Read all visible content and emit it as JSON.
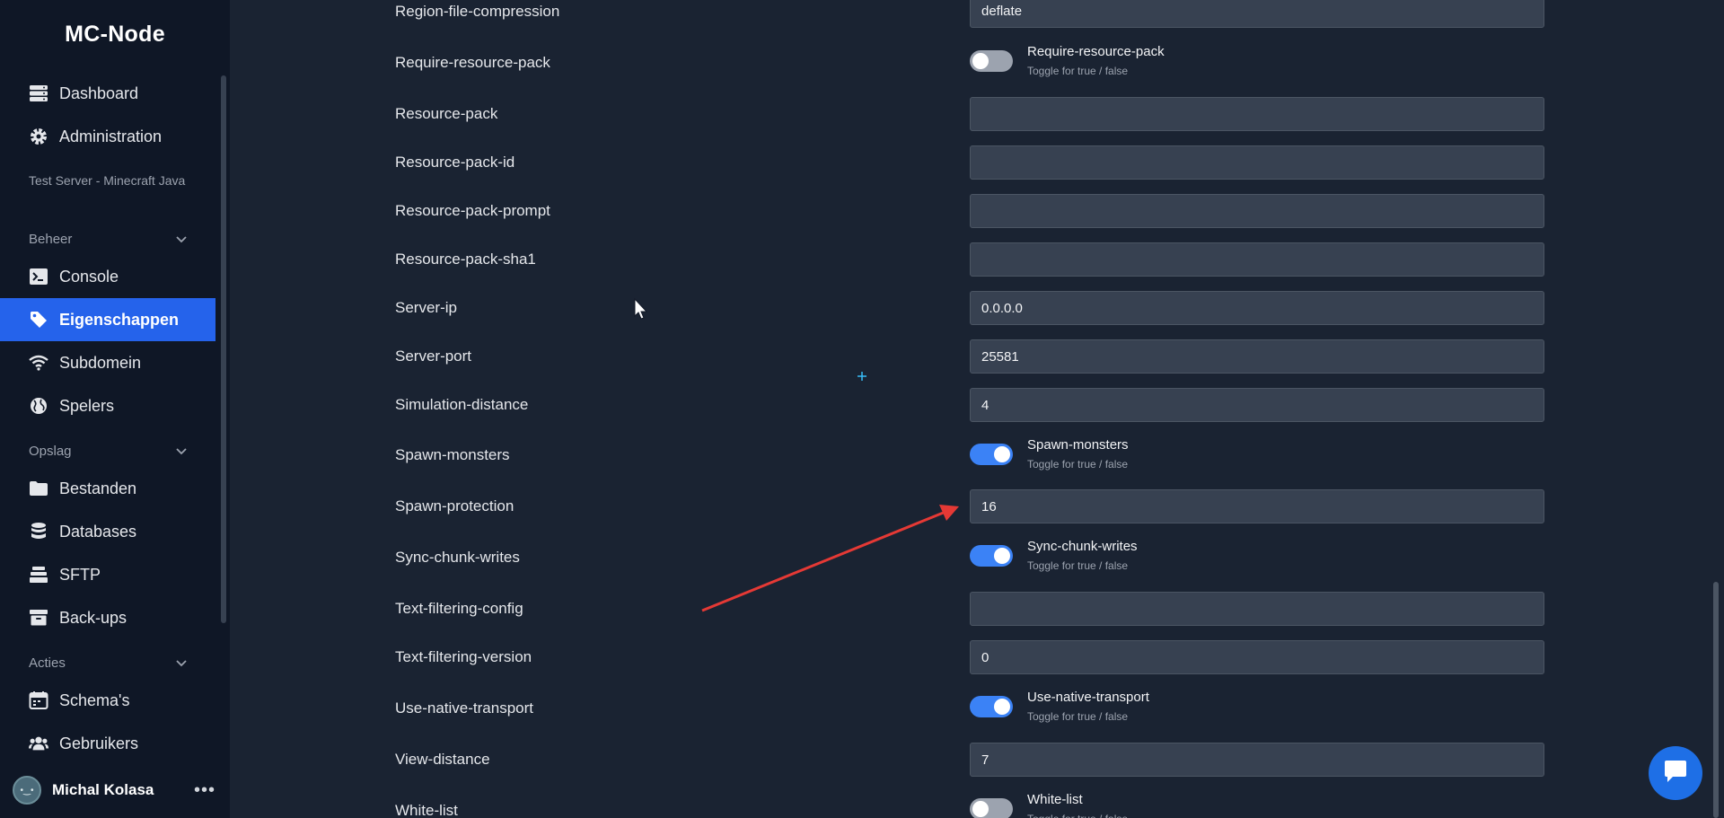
{
  "sidebar": {
    "brand": "MC-Node",
    "dashboard": "Dashboard",
    "administration": "Administration",
    "server_name": "Test Server - Minecraft Java",
    "beheer": "Beheer",
    "console": "Console",
    "eigenschappen": "Eigenschappen",
    "subdomein": "Subdomein",
    "spelers": "Spelers",
    "opslag": "Opslag",
    "bestanden": "Bestanden",
    "databases": "Databases",
    "sftp": "SFTP",
    "backups": "Back-ups",
    "acties": "Acties",
    "schema": "Schema's",
    "gebruikers": "Gebruikers",
    "user_name": "Michal Kolasa",
    "accent": "#2563eb"
  },
  "properties": {
    "toggle_sub": "Toggle for true / false",
    "region_file_compression": {
      "label": "Region-file-compression",
      "value": "deflate"
    },
    "require_resource_pack": {
      "label": "Require-resource-pack",
      "toggle_title": "Require-resource-pack",
      "on": false
    },
    "resource_pack": {
      "label": "Resource-pack",
      "value": ""
    },
    "resource_pack_id": {
      "label": "Resource-pack-id",
      "value": ""
    },
    "resource_pack_prompt": {
      "label": "Resource-pack-prompt",
      "value": ""
    },
    "resource_pack_sha1": {
      "label": "Resource-pack-sha1",
      "value": ""
    },
    "server_ip": {
      "label": "Server-ip",
      "value": "0.0.0.0"
    },
    "server_port": {
      "label": "Server-port",
      "value": "25581"
    },
    "simulation_distance": {
      "label": "Simulation-distance",
      "value": "4"
    },
    "spawn_monsters": {
      "label": "Spawn-monsters",
      "toggle_title": "Spawn-monsters",
      "on": true
    },
    "spawn_protection": {
      "label": "Spawn-protection",
      "value": "16"
    },
    "sync_chunk_writes": {
      "label": "Sync-chunk-writes",
      "toggle_title": "Sync-chunk-writes",
      "on": true
    },
    "text_filtering_config": {
      "label": "Text-filtering-config",
      "value": ""
    },
    "text_filtering_version": {
      "label": "Text-filtering-version",
      "value": "0"
    },
    "use_native_transport": {
      "label": "Use-native-transport",
      "toggle_title": "Use-native-transport",
      "on": true
    },
    "view_distance": {
      "label": "View-distance",
      "value": "7"
    },
    "white_list": {
      "label": "White-list",
      "toggle_title": "White-list",
      "on": false
    }
  },
  "colors": {
    "toggle_on": "#3b82f6",
    "toggle_off": "#9ca3af",
    "annotation_arrow": "#e53935"
  }
}
